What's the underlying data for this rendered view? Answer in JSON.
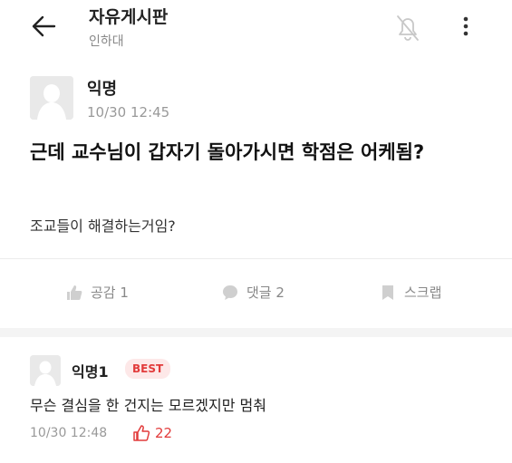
{
  "header": {
    "title": "자유게시판",
    "subtitle": "인하대",
    "icons": {
      "back": "back-arrow-icon",
      "bell": "notification-off-icon",
      "more": "more-vertical-icon"
    }
  },
  "post": {
    "author": "익명",
    "time": "10/30 12:45",
    "title": "근데 교수님이 갑자기 돌아가시면 학점은 어케됨?",
    "body": "조교들이 해결하는거임?",
    "actions": {
      "like": "공감 1",
      "comment": "댓글 2",
      "scrap": "스크랩"
    }
  },
  "comments": [
    {
      "author": "익명1",
      "badge": "BEST",
      "body": "무슨 결심을 한 건지는 모르겠지만 멈춰",
      "time": "10/30 12:48",
      "likes": "22"
    }
  ],
  "colors": {
    "accent_red": "#e23b3b",
    "muted": "#999999"
  }
}
